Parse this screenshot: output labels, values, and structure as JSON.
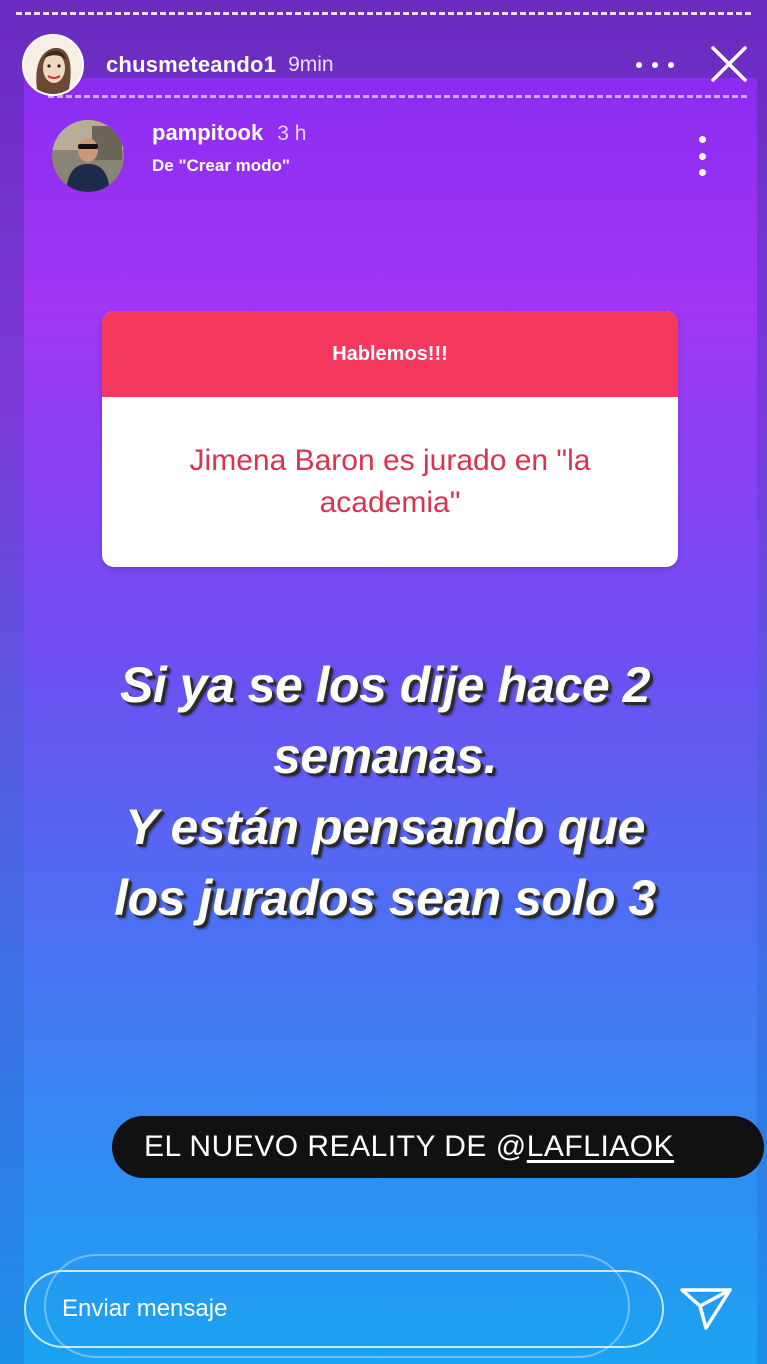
{
  "story": {
    "user": "chusmeteando1",
    "time": "9min"
  },
  "repost": {
    "user": "pampitook",
    "time": "3 h",
    "subtitle": "De \"Crear modo\""
  },
  "question_box": {
    "header": "Hablemos!!!",
    "body": "Jimena Baron es jurado en \"la academia\""
  },
  "main_text": {
    "line1": "Si ya se los dije hace 2",
    "line2": "semanas.",
    "line3": "Y están pensando que",
    "line4": "los jurados sean solo 3"
  },
  "tag": {
    "prefix": "EL NUEVO REALITY DE @",
    "handle": "LAFLIAOK"
  },
  "composer": {
    "placeholder": "Enviar mensaje"
  },
  "icons": {
    "more": "more-horizontal-icon",
    "close": "close-icon",
    "kebab": "more-vertical-icon",
    "send": "send-icon"
  },
  "colors": {
    "question_header": "#f5385e",
    "question_text": "#d9344c"
  }
}
